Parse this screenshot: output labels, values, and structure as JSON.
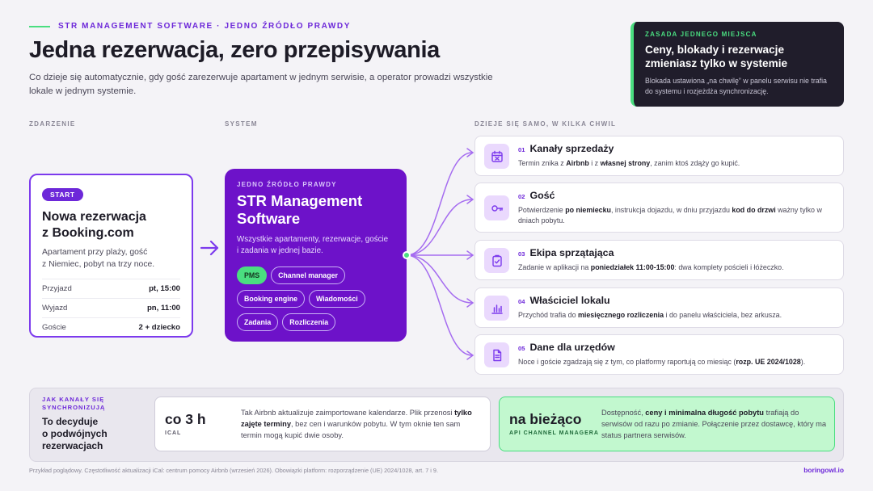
{
  "header": {
    "kicker": "STR MANAGEMENT SOFTWARE · JEDNO ŹRÓDŁO PRAWDY",
    "title": "Jedna rezerwacja, zero przepisywania",
    "lead": "Co dzieje się automatycznie, gdy gość zarezerwuje apartament w jednym serwisie, a operator prowadzi wszystkie lokale w jednym systemie."
  },
  "rule_box": {
    "kicker": "ZASADA JEDNEGO MIEJSCA",
    "title": "Ceny, blokady i rezerwacje zmieniasz tylko w systemie",
    "desc": "Blokada ustawiona „na chwilę” w panelu serwisu nie trafia do systemu i rozjeżdża synchronizację."
  },
  "columns": {
    "event": "ZDARZENIE",
    "system": "SYSTEM",
    "outcomes": "DZIEJE SIĘ SAMO, W KILKA CHWIL"
  },
  "event": {
    "badge": "START",
    "title_1": "Nowa rezerwacja",
    "title_2": "z Booking.com",
    "desc_1": "Apartament przy plaży, gość",
    "desc_2": "z Niemiec, pobyt na trzy noce.",
    "rows": [
      {
        "label": "Przyjazd",
        "value": "pt, 15:00"
      },
      {
        "label": "Wyjazd",
        "value": "pn, 11:00"
      },
      {
        "label": "Goście",
        "value": "2 + dziecko"
      }
    ]
  },
  "system": {
    "kicker": "JEDNO ŹRÓDŁO PRAWDY",
    "title_1": "STR Management",
    "title_2": "Software",
    "desc_1": "Wszystkie apartamenty, rezerwacje, goście",
    "desc_2": "i zadania w jednej bazie.",
    "modules": [
      "PMS",
      "Channel manager",
      "Booking engine",
      "Wiadomości",
      "Zadania",
      "Rozliczenia"
    ]
  },
  "outcomes": [
    {
      "num": "01",
      "name": "Kanały sprzedaży",
      "icon": "calendar-x-icon",
      "desc": [
        {
          "t": "Termin znika z "
        },
        {
          "t": "Airbnb",
          "b": true
        },
        {
          "t": " i z "
        },
        {
          "t": "własnej strony",
          "b": true
        },
        {
          "t": ", zanim ktoś zdąży go kupić."
        }
      ]
    },
    {
      "num": "02",
      "name": "Gość",
      "icon": "key-icon",
      "desc": [
        {
          "t": "Potwierdzenie "
        },
        {
          "t": "po niemiecku",
          "b": true
        },
        {
          "t": ", instrukcja dojazdu, w dniu przyjazdu "
        },
        {
          "t": "kod do drzwi",
          "b": true
        },
        {
          "t": " ważny tylko w dniach pobytu."
        }
      ]
    },
    {
      "num": "03",
      "name": "Ekipa sprzątająca",
      "icon": "clipboard-check-icon",
      "desc": [
        {
          "t": "Zadanie w aplikacji na "
        },
        {
          "t": "poniedziałek 11:00-15:00",
          "b": true
        },
        {
          "t": ": dwa komplety pościeli i łóżeczko."
        }
      ]
    },
    {
      "num": "04",
      "name": "Właściciel lokalu",
      "icon": "bar-chart-icon",
      "desc": [
        {
          "t": "Przychód trafia do "
        },
        {
          "t": "miesięcznego rozliczenia",
          "b": true
        },
        {
          "t": " i do panelu właściciela, bez arkusza."
        }
      ]
    },
    {
      "num": "05",
      "name": "Dane dla urzędów",
      "icon": "document-icon",
      "desc": [
        {
          "t": "Noce i goście zgadzają się z tym, co platformy raportują co miesiąc ("
        },
        {
          "t": "rozp. UE 2024/1028",
          "b": true
        },
        {
          "t": ")."
        }
      ]
    }
  ],
  "sync": {
    "kicker_1": "JAK KANAŁY SIĘ",
    "kicker_2": "SYNCHRONIZUJĄ",
    "title_1": "To decyduje",
    "title_2": "o podwójnych",
    "title_3": "rezerwacjach",
    "ical": {
      "big": "co 3 h",
      "sub": "ICAL",
      "desc": [
        {
          "t": "Tak Airbnb aktualizuje zaimportowane kalendarze. Plik przenosi "
        },
        {
          "t": "tylko zajęte terminy",
          "b": true
        },
        {
          "t": ", bez cen i warunków pobytu. W tym oknie ten sam termin mogą kupić dwie osoby."
        }
      ]
    },
    "api": {
      "big": "na bieżąco",
      "sub": "API CHANNEL MANAGERA",
      "desc": [
        {
          "t": "Dostępność, "
        },
        {
          "t": "ceny i minimalna długość pobytu",
          "b": true
        },
        {
          "t": " trafiają do serwisów od razu po zmianie. Połączenie przez dostawcę, który ma status partnera serwisów."
        }
      ]
    }
  },
  "footer": {
    "note": "Przykład poglądowy. Częstotliwość aktualizacji iCal: centrum pomocy Airbnb (wrzesień 2026). Obowiązki platform: rozporządzenie (UE) 2024/1028, art. 7 i 9.",
    "brand": "boringowl.io"
  },
  "colors": {
    "accent": "#6d12c9",
    "accent_light": "#ead9fd",
    "green": "#4ade80",
    "dark": "#201d2b",
    "line": "#a56cf0"
  }
}
